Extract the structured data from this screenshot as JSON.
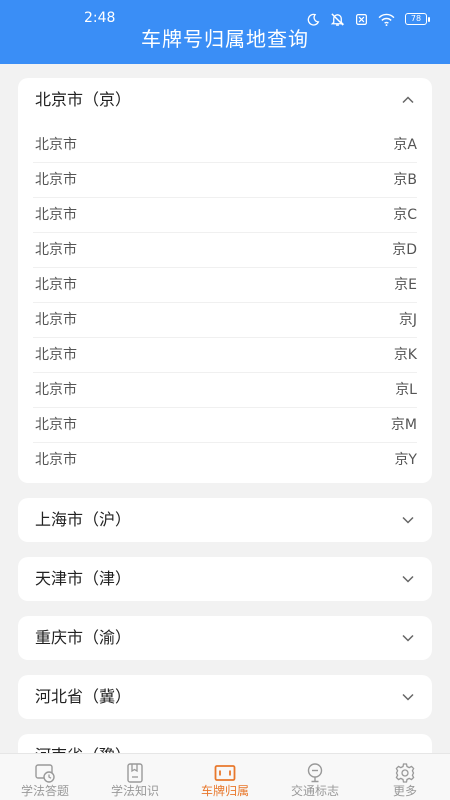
{
  "status": {
    "time": "2:48",
    "battery": "78",
    "icons": [
      "moon-icon",
      "mute-icon",
      "sim-off-icon",
      "wifi-icon",
      "battery-icon"
    ]
  },
  "header": {
    "title": "车牌号归属地查询"
  },
  "expanded": {
    "name": "北京市（京）",
    "rows": [
      {
        "city": "北京市",
        "code": "京A"
      },
      {
        "city": "北京市",
        "code": "京B"
      },
      {
        "city": "北京市",
        "code": "京C"
      },
      {
        "city": "北京市",
        "code": "京D"
      },
      {
        "city": "北京市",
        "code": "京E"
      },
      {
        "city": "北京市",
        "code": "京J"
      },
      {
        "city": "北京市",
        "code": "京K"
      },
      {
        "city": "北京市",
        "code": "京L"
      },
      {
        "city": "北京市",
        "code": "京M"
      },
      {
        "city": "北京市",
        "code": "京Y"
      }
    ]
  },
  "collapsed": [
    {
      "name": "上海市（沪）"
    },
    {
      "name": "天津市（津）"
    },
    {
      "name": "重庆市（渝）"
    },
    {
      "name": "河北省（冀）"
    },
    {
      "name": "河南省（豫）"
    }
  ],
  "tabbar": {
    "tabs": [
      {
        "label": "学法答题",
        "icon": "quiz-icon"
      },
      {
        "label": "学法知识",
        "icon": "knowledge-icon"
      },
      {
        "label": "车牌归属",
        "icon": "license-plate-icon",
        "active": true
      },
      {
        "label": "交通标志",
        "icon": "traffic-sign-icon"
      },
      {
        "label": "更多",
        "icon": "gear-icon"
      }
    ]
  },
  "colors": {
    "header": "#3a8ef6",
    "active_tab": "#e8782c",
    "background": "#f2f2f2"
  }
}
